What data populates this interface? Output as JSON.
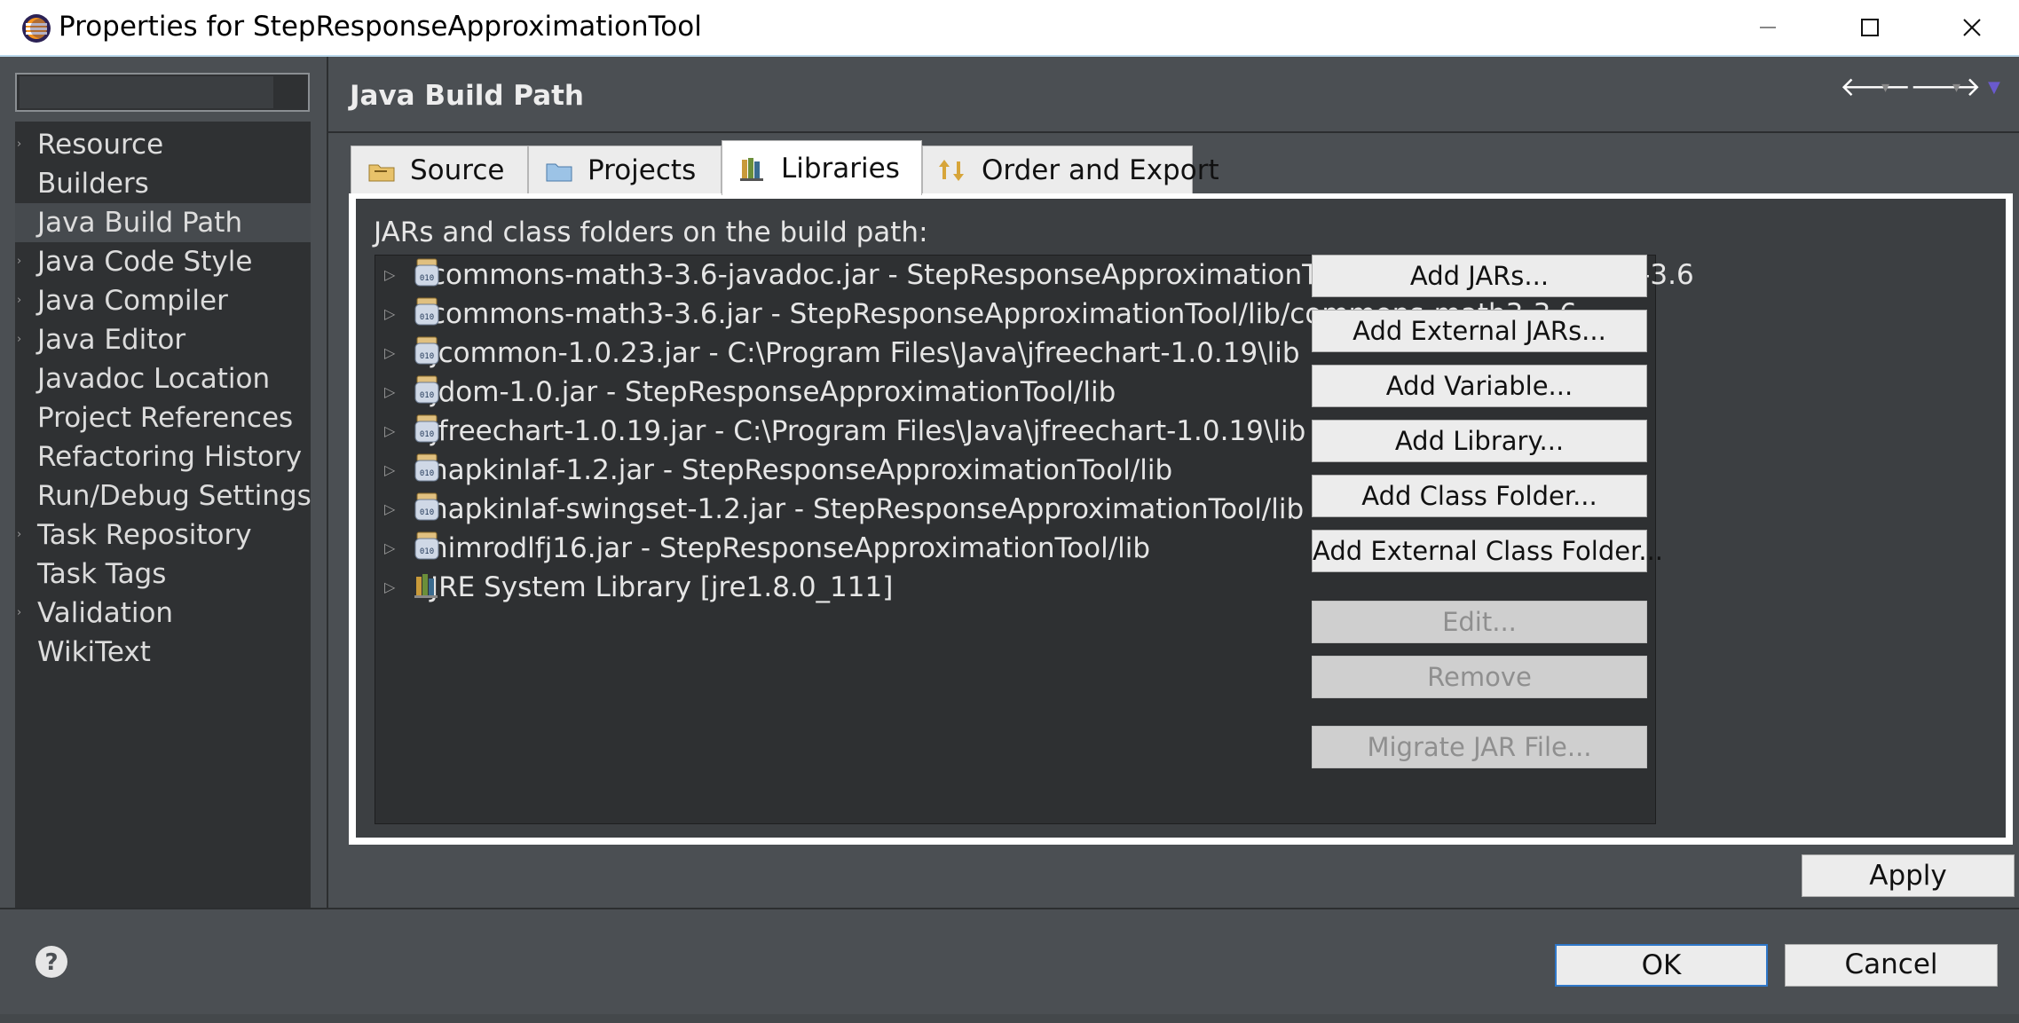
{
  "window": {
    "title": "Properties for StepResponseApproximationTool",
    "controls": {
      "minimize": "minimize-icon",
      "maximize": "maximize-icon",
      "close": "close-icon"
    }
  },
  "filter": {
    "value": ""
  },
  "nav": {
    "items": [
      {
        "label": "Resource",
        "expandable": true
      },
      {
        "label": "Builders",
        "expandable": false
      },
      {
        "label": "Java Build Path",
        "expandable": false,
        "selected": true
      },
      {
        "label": "Java Code Style",
        "expandable": true
      },
      {
        "label": "Java Compiler",
        "expandable": true
      },
      {
        "label": "Java Editor",
        "expandable": true
      },
      {
        "label": "Javadoc Location",
        "expandable": false
      },
      {
        "label": "Project References",
        "expandable": false
      },
      {
        "label": "Refactoring History",
        "expandable": false
      },
      {
        "label": "Run/Debug Settings",
        "expandable": false
      },
      {
        "label": "Task Repository",
        "expandable": true
      },
      {
        "label": "Task Tags",
        "expandable": false
      },
      {
        "label": "Validation",
        "expandable": true
      },
      {
        "label": "WikiText",
        "expandable": false
      }
    ]
  },
  "page": {
    "title": "Java Build Path"
  },
  "tabs": [
    {
      "label": "Source",
      "icon": "source-folder-icon"
    },
    {
      "label": "Projects",
      "icon": "project-folder-icon"
    },
    {
      "label": "Libraries",
      "icon": "libraries-icon",
      "active": true
    },
    {
      "label": "Order and Export",
      "icon": "order-export-icon"
    }
  ],
  "libraries": {
    "list_label": "JARs and class folders on the build path:",
    "entries": [
      {
        "text": "commons-math3-3.6-javadoc.jar - StepResponseApproximationTool/lib/commons-math3-3.6",
        "icon": "jar-icon"
      },
      {
        "text": "commons-math3-3.6.jar - StepResponseApproximationTool/lib/commons-math3-3.6",
        "icon": "jar-icon"
      },
      {
        "text": "jcommon-1.0.23.jar - C:\\Program Files\\Java\\jfreechart-1.0.19\\lib",
        "icon": "jar-icon"
      },
      {
        "text": "jdom-1.0.jar - StepResponseApproximationTool/lib",
        "icon": "jar-icon"
      },
      {
        "text": "jfreechart-1.0.19.jar - C:\\Program Files\\Java\\jfreechart-1.0.19\\lib",
        "icon": "jar-icon"
      },
      {
        "text": "napkinlaf-1.2.jar - StepResponseApproximationTool/lib",
        "icon": "jar-icon"
      },
      {
        "text": "napkinlaf-swingset-1.2.jar - StepResponseApproximationTool/lib",
        "icon": "jar-icon"
      },
      {
        "text": "nimrodlfj16.jar - StepResponseApproximationTool/lib",
        "icon": "jar-icon"
      },
      {
        "text": "JRE System Library [jre1.8.0_111]",
        "icon": "library-icon"
      }
    ],
    "buttons": [
      {
        "label": "Add JARs...",
        "enabled": true
      },
      {
        "label": "Add External JARs...",
        "enabled": true
      },
      {
        "label": "Add Variable...",
        "enabled": true
      },
      {
        "label": "Add Library...",
        "enabled": true
      },
      {
        "label": "Add Class Folder...",
        "enabled": true
      },
      {
        "label": "Add External Class Folder...",
        "enabled": true
      },
      {
        "label": "Edit...",
        "enabled": false
      },
      {
        "label": "Remove",
        "enabled": false
      },
      {
        "label": "Migrate JAR File...",
        "enabled": false
      }
    ]
  },
  "footer": {
    "apply": "Apply",
    "ok": "OK",
    "cancel": "Cancel",
    "help_icon": "help-icon"
  },
  "colors": {
    "background": "#4b4f53",
    "panel": "#3c3f42",
    "list": "#2e3032",
    "ok_border": "#2f77c8"
  }
}
